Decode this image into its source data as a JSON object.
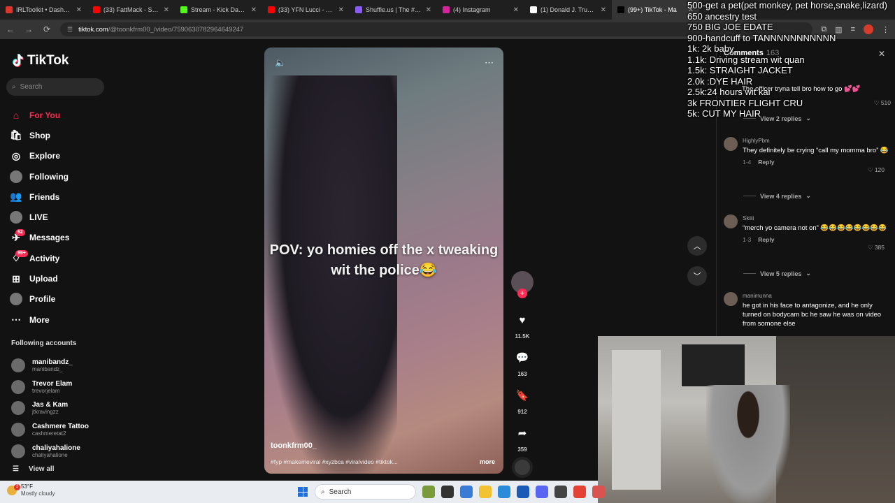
{
  "browser": {
    "tabs": [
      {
        "title": "IRLToolkit • Dashboard",
        "color": "#e0352b"
      },
      {
        "title": "(33) FattMack - Start N",
        "color": "#ff0000"
      },
      {
        "title": "Stream - Kick Dashboa",
        "color": "#53fc18"
      },
      {
        "title": "(33) YFN Lucci - ON M",
        "color": "#ff0000"
      },
      {
        "title": "Shuffle.us | The #1 Fre",
        "color": "#8a5cf6"
      },
      {
        "title": "(4) Instagram",
        "color": "#d6249f"
      },
      {
        "title": "(1) Donald J. Trump o",
        "color": "#ffffff"
      },
      {
        "title": "(99+) TikTok - Ma",
        "color": "#000000"
      }
    ],
    "url_host": "tiktok.com",
    "url_path": "/@toonkfrm00_/video/7590630782964649247"
  },
  "sidebar": {
    "logo": "TikTok",
    "search_placeholder": "Search",
    "nav": [
      {
        "label": "For You",
        "icon": "home-icon",
        "active": true
      },
      {
        "label": "Shop",
        "icon": "shop-icon"
      },
      {
        "label": "Explore",
        "icon": "compass-icon"
      },
      {
        "label": "Following",
        "icon": "avatar"
      },
      {
        "label": "Friends",
        "icon": "friends-icon"
      },
      {
        "label": "LIVE",
        "icon": "avatar"
      },
      {
        "label": "Messages",
        "icon": "messages-icon",
        "badge": "62"
      },
      {
        "label": "Activity",
        "icon": "activity-icon",
        "badge": "99+"
      },
      {
        "label": "Upload",
        "icon": "upload-icon"
      },
      {
        "label": "Profile",
        "icon": "avatar"
      },
      {
        "label": "More",
        "icon": "more-icon"
      }
    ],
    "following_title": "Following accounts",
    "following": [
      {
        "name": "manibandz_",
        "handle": "manibandz_"
      },
      {
        "name": "Trevor Elam",
        "handle": "trevorjelam"
      },
      {
        "name": "Jas & Kam",
        "handle": "jtkravingzz"
      },
      {
        "name": "Cashmere Tattoo",
        "handle": "cashmeretat2"
      },
      {
        "name": "chaliyahalione",
        "handle": "chaliyahalione"
      }
    ],
    "view_all": "View all"
  },
  "video": {
    "caption": "POV: yo homies off the x tweaking wit the police😂",
    "author": "toonkfrm00_",
    "tags": "#fyp #makemeviral #xyzbca #viralvideo #tiktok...",
    "more": "more"
  },
  "actions": {
    "likes": "11.5K",
    "comments": "163",
    "saves": "912",
    "shares": "359"
  },
  "comments": {
    "title": "Comments",
    "count": "163",
    "first_text": "The officer tryna tell bro how to go 💕💕",
    "first_likes": "510",
    "items": [
      {
        "view_replies_before": "View 2 replies",
        "user": "HighlyPbm",
        "text": "They definitely be crying “call my momma bro” 😂",
        "date": "1-4",
        "reply": "Reply",
        "likes": "120",
        "view_replies_after": "View 4 replies"
      },
      {
        "user": "Skiiii",
        "text": "“merch yo camera not on” 😂😂😂😂😂😂😂😂",
        "date": "1-3",
        "reply": "Reply",
        "likes": "385",
        "view_replies_after": "View 5 replies"
      },
      {
        "user": "manimunna",
        "text": "he got in his face to antagonize, and he only turned on bodycam bc he saw he was on video from somone else"
      }
    ]
  },
  "goals": [
    "500-get a pet(pet monkey, pet horse,snake,lizard)",
    "650 ancestry test",
    "750 BIG JOE EDATE",
    "900-handcuff to TANNNNNNNNNNN",
    "1k: 2k baby",
    "1.1k: Driving stream wit quan",
    "1.5k: STRAIGHT JACKET",
    "2.0k :DYE HAIR",
    "2.5k:24 hours wit kai",
    "3k FRONTIER FLIGHT CRU",
    "5k: CUT MY HAIR"
  ],
  "taskbar": {
    "temp": "53°F",
    "weather": "Mostly cloudy",
    "notif": "3",
    "search": "Search"
  }
}
